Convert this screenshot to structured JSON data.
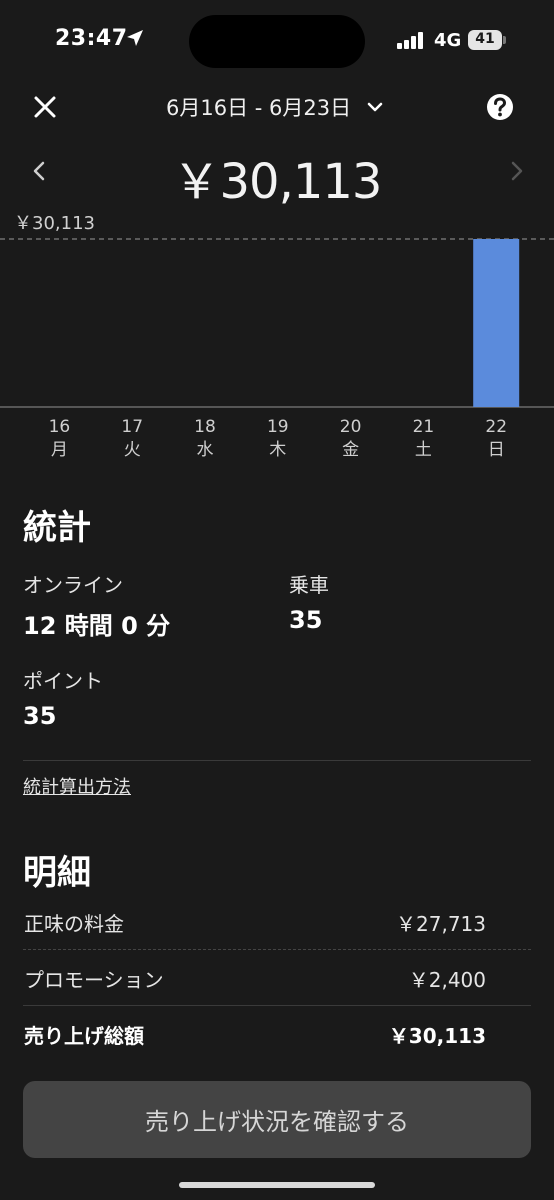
{
  "status_bar": {
    "time": "23:47",
    "network": "4G",
    "battery": "41",
    "icons": [
      "location-arrow-icon",
      "signal-icon",
      "battery-icon"
    ]
  },
  "header": {
    "date_range": "6月16日 - 6月23日",
    "icons": [
      "close-icon",
      "chevron-down-icon",
      "help-icon",
      "chevron-left-icon",
      "chevron-right-icon"
    ]
  },
  "summary": {
    "total": "￥30,113"
  },
  "chart_data": {
    "type": "bar",
    "categories": [
      "16",
      "17",
      "18",
      "19",
      "20",
      "21",
      "22"
    ],
    "weekdays": [
      "月",
      "火",
      "水",
      "木",
      "金",
      "土",
      "日"
    ],
    "values": [
      0,
      0,
      0,
      0,
      0,
      0,
      30113
    ],
    "reference_label": "￥30,113",
    "reference_value": 30113,
    "ylim": [
      0,
      30113
    ],
    "bar_color": "#5b8bdc",
    "grid": false
  },
  "stats": {
    "title": "統計",
    "online_label": "オンライン",
    "online_value": "12 時間 0 分",
    "rides_label": "乗車",
    "rides_value": "35",
    "points_label": "ポイント",
    "points_value": "35",
    "method_link": "統計算出方法"
  },
  "breakdown": {
    "title": "明細",
    "rows": [
      {
        "label": "正味の料金",
        "value": "￥27,713"
      },
      {
        "label": "プロモーション",
        "value": "￥2,400"
      }
    ],
    "total_label": "売り上げ総額",
    "total_value": "￥30,113"
  },
  "cta": {
    "label": "売り上げ状況を確認する"
  },
  "colors": {
    "background": "#1a1a1a",
    "accent": "#5b8bdc",
    "button": "#444444"
  }
}
